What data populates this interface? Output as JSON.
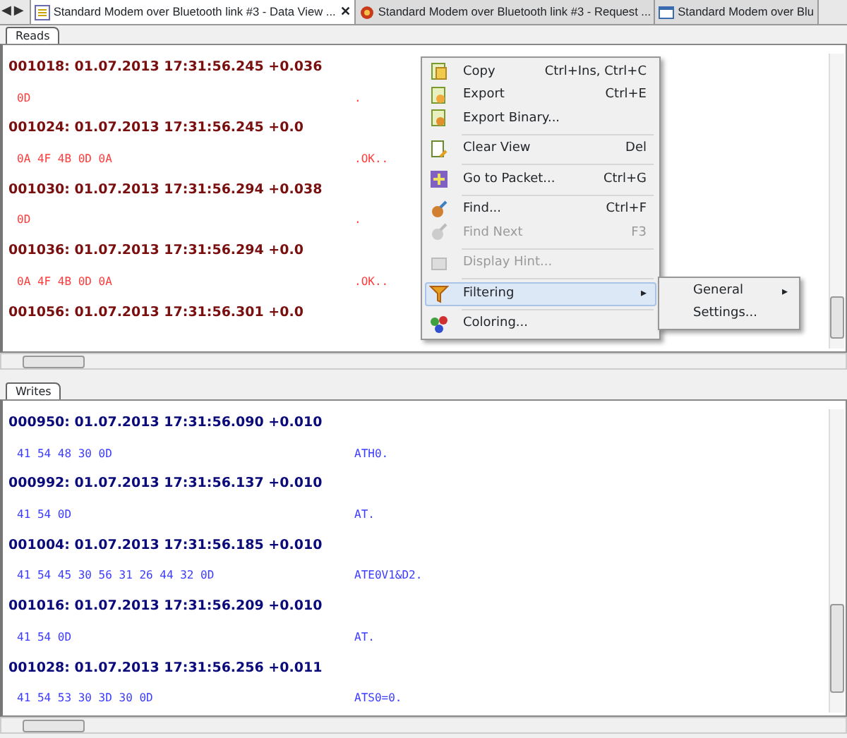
{
  "nav": {
    "back": "◀",
    "forward": "▶"
  },
  "tabs": [
    {
      "label": "Standard Modem over Bluetooth link #3 - Data View ...",
      "selected": true,
      "close": "✕"
    },
    {
      "label": "Standard Modem over Bluetooth link #3 - Request ...",
      "selected": false
    },
    {
      "label": "Standard Modem over Blu",
      "selected": false
    }
  ],
  "panes": [
    {
      "tab": "Reads",
      "kind": "reads",
      "records": [
        {
          "header": "001018: 01.07.2013 17:31:56.245 +0.036",
          "hex": "0D",
          "ascii": "."
        },
        {
          "header": "001024: 01.07.2013 17:31:56.245 +0.0",
          "hex": "0A 4F 4B 0D 0A",
          "ascii": ".OK.."
        },
        {
          "header": "001030: 01.07.2013 17:31:56.294 +0.038",
          "hex": "0D",
          "ascii": "."
        },
        {
          "header": "001036: 01.07.2013 17:31:56.294 +0.0",
          "hex": "0A 4F 4B 0D 0A",
          "ascii": ".OK.."
        },
        {
          "header": "001056: 01.07.2013 17:31:56.301 +0.0"
        }
      ]
    },
    {
      "tab": "Writes",
      "kind": "writes",
      "records": [
        {
          "header": "000950: 01.07.2013 17:31:56.090 +0.010",
          "hex": "41 54 48 30 0D",
          "ascii": "ATH0."
        },
        {
          "header": "000992: 01.07.2013 17:31:56.137 +0.010",
          "hex": "41 54 0D",
          "ascii": "AT."
        },
        {
          "header": "001004: 01.07.2013 17:31:56.185 +0.010",
          "hex": "41 54 45 30 56 31 26 44 32 0D",
          "ascii": "ATE0V1&D2."
        },
        {
          "header": "001016: 01.07.2013 17:31:56.209 +0.010",
          "hex": "41 54 0D",
          "ascii": "AT."
        },
        {
          "header": "001028: 01.07.2013 17:31:56.256 +0.011",
          "hex": "41 54 53 30 3D 30 0D",
          "ascii": "ATS0=0."
        }
      ]
    }
  ],
  "menu": [
    {
      "kind": "item",
      "label": "Copy",
      "shortcut": "Ctrl+Ins, Ctrl+C",
      "disabled": false,
      "highlighted": false
    },
    {
      "kind": "item",
      "label": "Export",
      "shortcut": "Ctrl+E",
      "disabled": false,
      "highlighted": false
    },
    {
      "kind": "item",
      "label": "Export Binary...",
      "disabled": false,
      "highlighted": false
    },
    {
      "kind": "separator"
    },
    {
      "kind": "item",
      "label": "Clear View",
      "shortcut": "Del",
      "disabled": false,
      "highlighted": false
    },
    {
      "kind": "separator"
    },
    {
      "kind": "item",
      "label": "Go to Packet...",
      "shortcut": "Ctrl+G",
      "disabled": false,
      "highlighted": false
    },
    {
      "kind": "separator"
    },
    {
      "kind": "item",
      "label": "Find...",
      "shortcut": "Ctrl+F",
      "disabled": false,
      "highlighted": false
    },
    {
      "kind": "item",
      "label": "Find Next",
      "shortcut": "F3",
      "disabled": true,
      "highlighted": false
    },
    {
      "kind": "separator"
    },
    {
      "kind": "item",
      "label": "Display Hint...",
      "disabled": true,
      "highlighted": false
    },
    {
      "kind": "separator"
    },
    {
      "kind": "item",
      "label": "Filtering",
      "submenu_arrow": "▸",
      "disabled": false,
      "highlighted": true
    },
    {
      "kind": "separator"
    },
    {
      "kind": "item",
      "label": "Coloring...",
      "disabled": false,
      "highlighted": false
    }
  ],
  "submenu": [
    {
      "label": "General",
      "submenu_arrow": "▸"
    },
    {
      "label": "Settings..."
    }
  ]
}
